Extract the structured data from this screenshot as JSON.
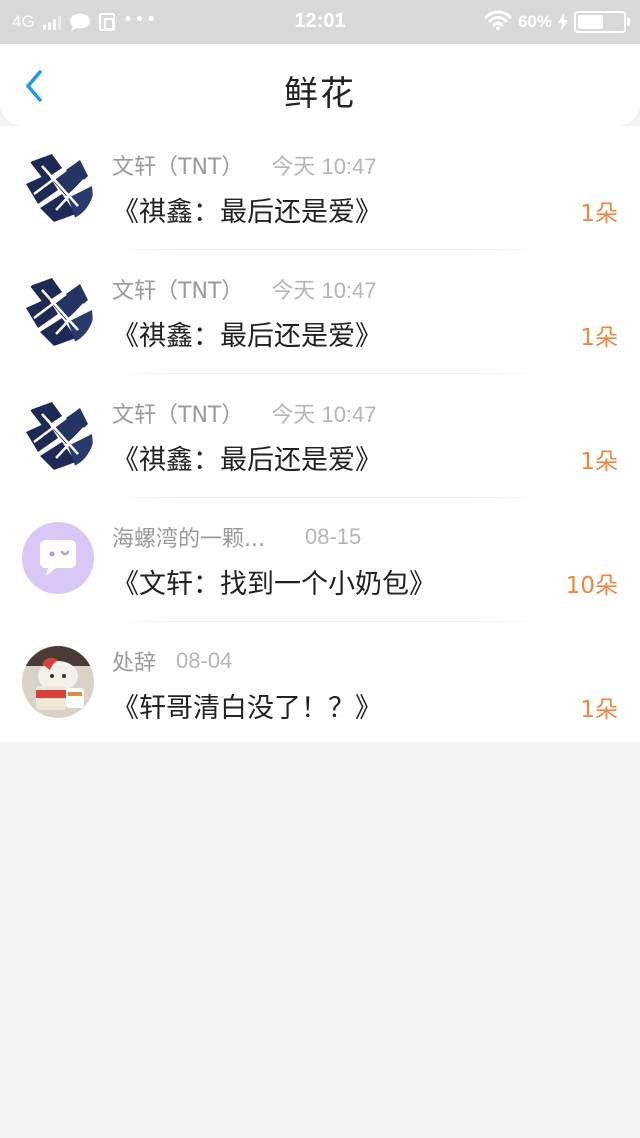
{
  "status_bar": {
    "network": "4G",
    "time": "12:01",
    "battery_percent_label": "60%",
    "battery_level": 0.6,
    "dots": "•••"
  },
  "header": {
    "title": "鲜花",
    "back_icon": "chevron-left-icon",
    "accent_color": "#2196f3"
  },
  "flowers": [
    {
      "user": "文轩（TNT）",
      "time": "今天 10:47",
      "title": "《祺鑫：最后还是爱》",
      "count": "1朵",
      "avatar": "ink-art-avatar"
    },
    {
      "user": "文轩（TNT）",
      "time": "今天 10:47",
      "title": "《祺鑫：最后还是爱》",
      "count": "1朵",
      "avatar": "ink-art-avatar"
    },
    {
      "user": "文轩（TNT）",
      "time": "今天 10:47",
      "title": "《祺鑫：最后还是爱》",
      "count": "1朵",
      "avatar": "ink-art-avatar"
    },
    {
      "user": "海螺湾的一颗...",
      "time": "08-15",
      "title": "《文轩：找到一个小奶包》",
      "count": "10朵",
      "avatar": "default-chat-avatar"
    },
    {
      "user": "处辞",
      "time": "08-04",
      "title": "《轩哥清白没了！？》",
      "count": "1朵",
      "avatar": "cartoon-bear-avatar"
    }
  ],
  "colors": {
    "count": "#f0863c",
    "status_bar_bg": "#d9d9d9",
    "page_bg": "#f4f4f4"
  }
}
